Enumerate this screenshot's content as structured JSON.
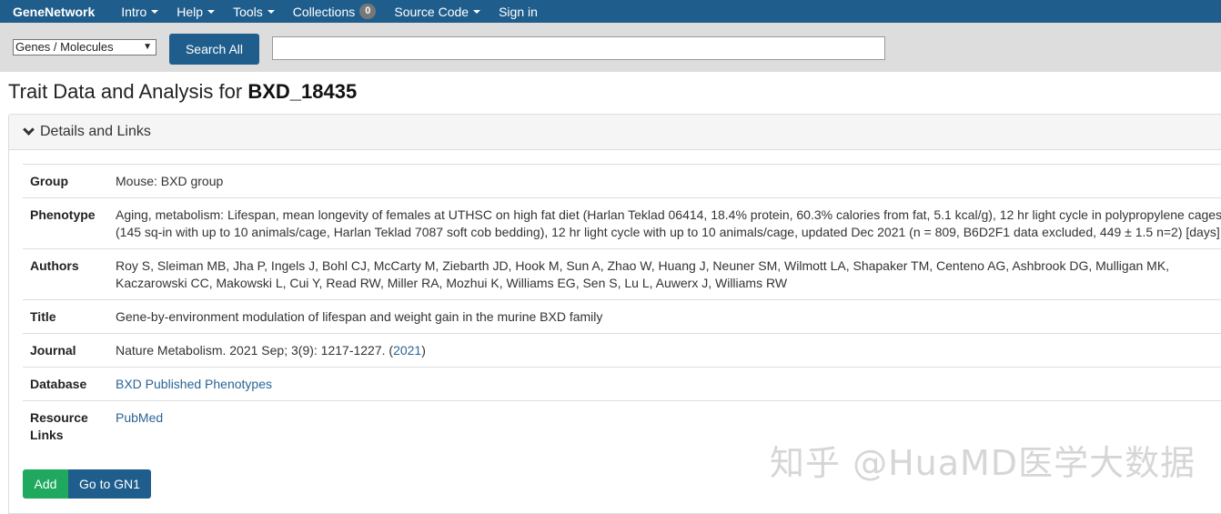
{
  "navbar": {
    "brand": "GeneNetwork",
    "items": [
      {
        "label": "Intro",
        "dropdown": true
      },
      {
        "label": "Help",
        "dropdown": true
      },
      {
        "label": "Tools",
        "dropdown": true
      },
      {
        "label": "Collections",
        "badge": "0"
      },
      {
        "label": "Source Code",
        "dropdown": true
      },
      {
        "label": "Sign in"
      }
    ]
  },
  "search": {
    "select_value": "Genes / Molecules",
    "button_label": "Search All",
    "input_value": ""
  },
  "page": {
    "title_prefix": "Trait Data and Analysis for ",
    "trait_id": "BXD_18435"
  },
  "panel": {
    "heading": "Details and Links"
  },
  "details": {
    "group": {
      "label": "Group",
      "value": "Mouse: BXD group"
    },
    "phenotype": {
      "label": "Phenotype",
      "line1": "Aging, metabolism: Lifespan, mean longevity of females at UTHSC on high fat diet (Harlan Teklad 06414, 18.4% protein, 60.3% calories from fat, 5.1 kcal/g), 12 hr light cycle in polypropylene cages",
      "line2": "(145 sq-in with up to 10 animals/cage, Harlan Teklad 7087 soft cob bedding), 12 hr light cycle with up to 10 animals/cage, updated Dec 2021 (n = 809, B6D2F1 data excluded, 449 ± 1.5 n=2) [days]"
    },
    "authors": {
      "label": "Authors",
      "line1": "Roy S, Sleiman MB, Jha P, Ingels J, Bohl CJ, McCarty M, Ziebarth JD, Hook M, Sun A, Zhao W, Huang J, Neuner SM, Wilmott LA, Shapaker TM, Centeno AG, Ashbrook DG, Mulligan MK,",
      "line2": "Kaczarowski CC, Makowski L, Cui Y, Read RW, Miller RA, Mozhui K, Williams EG, Sen S, Lu L, Auwerx J, Williams RW"
    },
    "title": {
      "label": "Title",
      "value": "Gene-by-environment modulation of lifespan and weight gain in the murine BXD family"
    },
    "journal": {
      "label": "Journal",
      "value": "Nature Metabolism. 2021 Sep; 3(9): 1217-1227. ",
      "paren_open": "(",
      "year_link": "2021",
      "paren_close": ")"
    },
    "database": {
      "label": "Database",
      "link": "BXD Published Phenotypes"
    },
    "resource_links": {
      "label_line1": "Resource",
      "label_line2": "Links",
      "link": "PubMed"
    }
  },
  "buttons": {
    "add": "Add",
    "go_gn1": "Go to GN1"
  },
  "watermark": "知乎 @HuaMD医学大数据",
  "colors": {
    "navbar_bg": "#1f5e8c",
    "search_bg": "#dddddd",
    "add_button": "#1ea95f",
    "link": "#2a6496"
  }
}
